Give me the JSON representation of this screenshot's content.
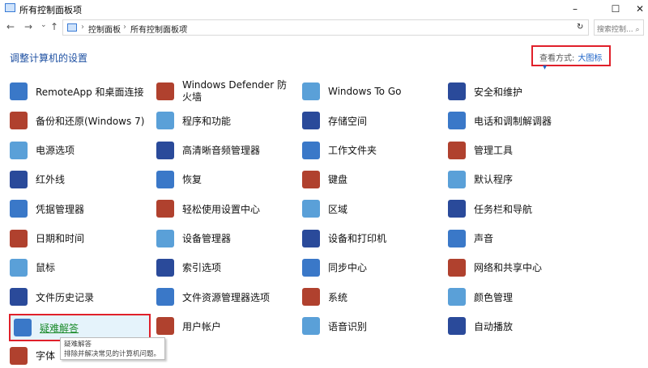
{
  "window": {
    "title": "所有控制面板项",
    "minimize": "–",
    "maximize": "☐",
    "close": "✕"
  },
  "nav": {
    "back": "←",
    "forward": "→",
    "recent": "⌄",
    "up": "↑",
    "crumbs": [
      "控制面板",
      "所有控制面板项"
    ],
    "sep": "›",
    "refresh": "↻",
    "search_placeholder": "搜索控制... ⌕"
  },
  "heading": "调整计算机的设置",
  "view": {
    "label": "查看方式:",
    "value": "大图标",
    "arrow": "▾"
  },
  "items": [
    [
      "RemoteApp 和桌面连接",
      "Windows Defender 防火墙",
      "Windows To Go",
      "安全和维护"
    ],
    [
      "备份和还原(Windows 7)",
      "程序和功能",
      "存储空间",
      "电话和调制解调器"
    ],
    [
      "电源选项",
      "高清晰音频管理器",
      "工作文件夹",
      "管理工具"
    ],
    [
      "红外线",
      "恢复",
      "键盘",
      "默认程序"
    ],
    [
      "凭据管理器",
      "轻松使用设置中心",
      "区域",
      "任务栏和导航"
    ],
    [
      "日期和时间",
      "设备管理器",
      "设备和打印机",
      "声音"
    ],
    [
      "鼠标",
      "索引选项",
      "同步中心",
      "网络和共享中心"
    ],
    [
      "文件历史记录",
      "文件资源管理器选项",
      "系统",
      "颜色管理"
    ],
    [
      "疑难解答",
      "用户帐户",
      "语音识别",
      "自动播放"
    ],
    [
      "字体"
    ]
  ],
  "icon_colors": [
    "#3a78c8",
    "#b0412e",
    "#5aa0d8",
    "#2a4a9a"
  ],
  "tooltip": {
    "title": "疑难解答",
    "text": "排除并解决常见的计算机问题。"
  }
}
